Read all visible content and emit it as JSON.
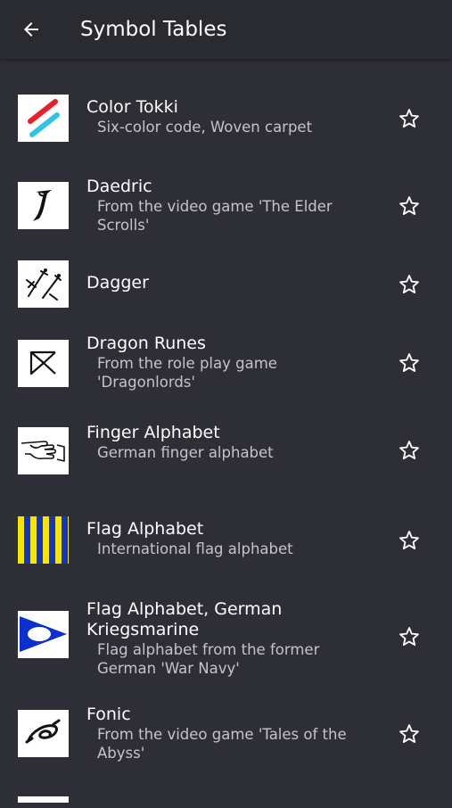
{
  "app_bar": {
    "title": "Symbol Tables",
    "back_icon": "arrow-back-icon"
  },
  "items": [
    {
      "title": "Color Tokki",
      "subtitle": "Six-color code, Woven carpet",
      "thumbnail": "color-tokki-thumbnail",
      "favorite_icon": "star-outline-icon"
    },
    {
      "title": "Daedric",
      "subtitle": "From the video game 'The Elder Scrolls'",
      "thumbnail": "daedric-thumbnail",
      "favorite_icon": "star-outline-icon"
    },
    {
      "title": "Dagger",
      "subtitle": "",
      "thumbnail": "dagger-thumbnail",
      "favorite_icon": "star-outline-icon"
    },
    {
      "title": "Dragon Runes",
      "subtitle": "From the role play game 'Dragonlords'",
      "thumbnail": "dragon-runes-thumbnail",
      "favorite_icon": "star-outline-icon"
    },
    {
      "title": "Finger Alphabet",
      "subtitle": "German finger alphabet",
      "thumbnail": "finger-alphabet-thumbnail",
      "favorite_icon": "star-outline-icon"
    },
    {
      "title": "Flag Alphabet",
      "subtitle": "International flag alphabet",
      "thumbnail": "flag-alphabet-thumbnail",
      "favorite_icon": "star-outline-icon"
    },
    {
      "title": "Flag Alphabet, German Kriegsmarine",
      "subtitle": "Flag alphabet from the former German 'War Navy'",
      "thumbnail": "flag-kriegsmarine-thumbnail",
      "favorite_icon": "star-outline-icon"
    },
    {
      "title": "Fonic",
      "subtitle": "From the video game 'Tales of the Abyss'",
      "thumbnail": "fonic-thumbnail",
      "favorite_icon": "star-outline-icon"
    }
  ],
  "colors": {
    "background": "#2e2e36",
    "app_bar": "#2a2a31",
    "title_text": "#ffffff",
    "subtitle_text": "#c4c4c8",
    "tokki_red": "#e8202a",
    "tokki_cyan": "#2fc3e6",
    "flag_yellow": "#f5e500",
    "flag_blue": "#1233c8",
    "pennant_blue": "#0c2fd0"
  }
}
